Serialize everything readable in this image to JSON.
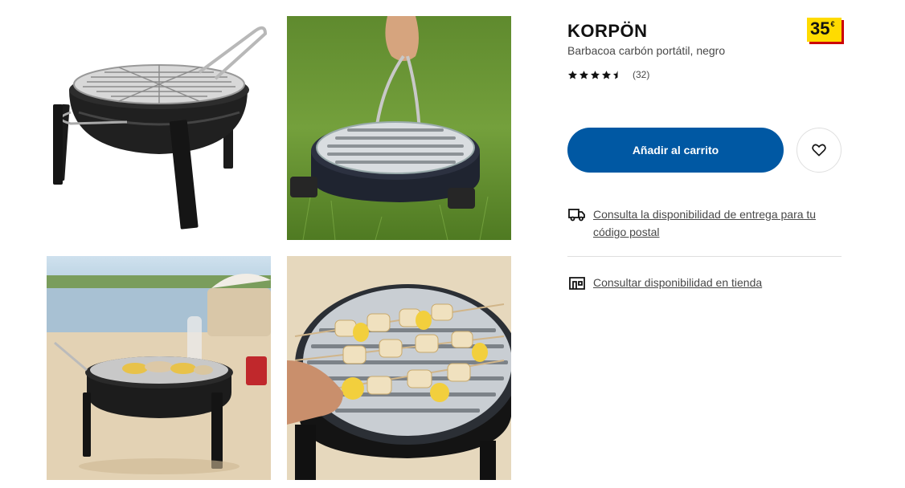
{
  "product": {
    "name": "KORPÖN",
    "description": "Barbacoa carbón portátil, negro",
    "price_integer": "35",
    "price_currency": "€",
    "rating": 4.5,
    "review_count": "(32)"
  },
  "actions": {
    "add_to_cart": "Añadir al carrito"
  },
  "availability": {
    "delivery_link": "Consulta la disponibilidad de entrega para tu código postal",
    "store_link": "Consultar disponibilidad en tienda"
  },
  "gallery": {
    "images": [
      "grill-product-image",
      "grill-carried-on-grass-image",
      "grill-on-beach-image",
      "grill-skewers-closeup-image"
    ]
  },
  "colors": {
    "brand_blue": "#0058a3",
    "price_yellow": "#ffdb00",
    "price_shadow_red": "#cc0008"
  },
  "icons": {
    "truck": "truck-icon",
    "store": "store-icon",
    "heart": "heart-icon",
    "star": "star-icon"
  }
}
